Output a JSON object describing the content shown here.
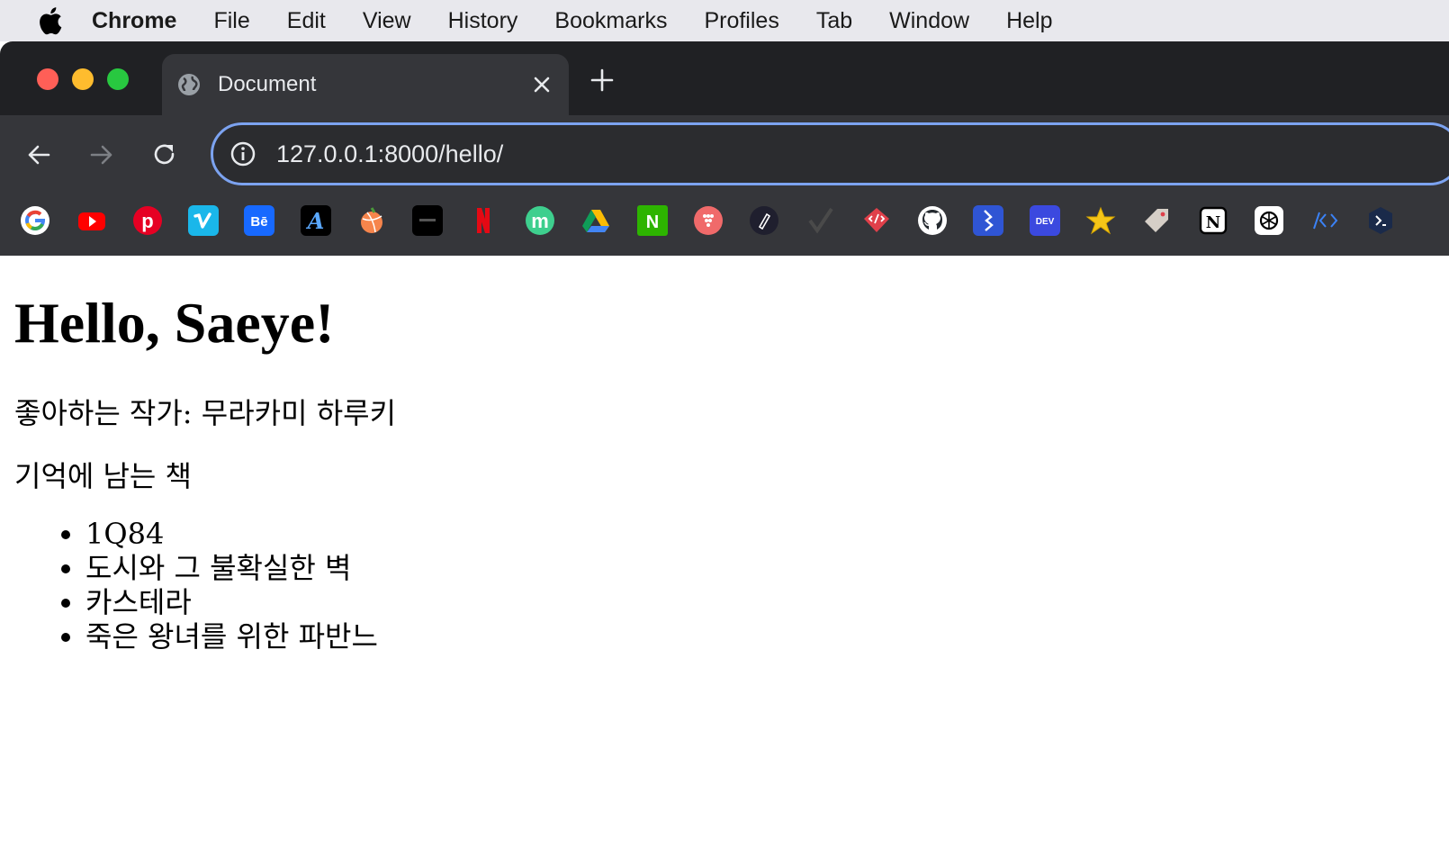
{
  "menubar": {
    "app_name": "Chrome",
    "items": [
      "File",
      "Edit",
      "View",
      "History",
      "Bookmarks",
      "Profiles",
      "Tab",
      "Window",
      "Help"
    ]
  },
  "tab": {
    "title": "Document",
    "favicon": "globe-icon"
  },
  "toolbar": {
    "url": "127.0.0.1:8000/hello/"
  },
  "bookmarks": [
    {
      "name": "google-bookmark",
      "color": "#ffffff"
    },
    {
      "name": "youtube-bookmark",
      "color": "#ff0000"
    },
    {
      "name": "pinterest-bookmark",
      "color": "#e60023"
    },
    {
      "name": "vimeo-bookmark",
      "color": "#1ab7ea"
    },
    {
      "name": "behance-bookmark",
      "color": "#1769ff"
    },
    {
      "name": "font-bookmark",
      "color": "#000000"
    },
    {
      "name": "dribbble-bookmark",
      "color": "#ea4c89"
    },
    {
      "name": "dark-site-bookmark",
      "color": "#000000"
    },
    {
      "name": "netflix-bookmark",
      "color": "#e50914"
    },
    {
      "name": "m-bookmark",
      "color": "#3ecf8e"
    },
    {
      "name": "google-drive-bookmark",
      "color": "#34a853"
    },
    {
      "name": "n-bookmark",
      "color": "#2db400"
    },
    {
      "name": "dots-bookmark",
      "color": "#f06a6a"
    },
    {
      "name": "pen-bookmark",
      "color": "#1f1f2e"
    },
    {
      "name": "check-bookmark",
      "color": "#4a4a4a"
    },
    {
      "name": "code-chat-bookmark",
      "color": "#e0404a"
    },
    {
      "name": "github-bookmark",
      "color": "#ffffff"
    },
    {
      "name": "bitbucket-bookmark",
      "color": "#2f55d4"
    },
    {
      "name": "dev-bookmark",
      "color": "#3b49df"
    },
    {
      "name": "star-bookmark",
      "color": "#f5c518"
    },
    {
      "name": "tag-bookmark",
      "color": "#d6cfc7"
    },
    {
      "name": "notion-bookmark",
      "color": "#ffffff"
    },
    {
      "name": "openai-bookmark",
      "color": "#ffffff"
    },
    {
      "name": "code-bookmark",
      "color": "#3b82f6"
    },
    {
      "name": "terminal-bookmark",
      "color": "#1a2a4a"
    }
  ],
  "page": {
    "heading": "Hello, Saeye!",
    "favorite_author": "좋아하는 작가: 무라카미 하루키",
    "books_heading": "기억에 남는 책",
    "books": [
      "1Q84",
      "도시와 그 불확실한 벽",
      "카스테라",
      "죽은 왕녀를 위한 파반느"
    ]
  }
}
